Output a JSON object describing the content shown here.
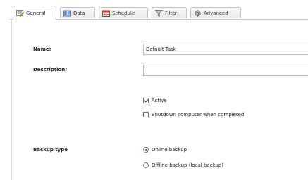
{
  "tabs": [
    {
      "label": "General",
      "icon": "general-icon",
      "active": true
    },
    {
      "label": "Data",
      "icon": "data-icon",
      "active": false
    },
    {
      "label": "Schedule",
      "icon": "calendar-icon",
      "active": false
    },
    {
      "label": "Filter",
      "icon": "filter-icon",
      "active": false
    },
    {
      "label": "Advanced",
      "icon": "gear-icon",
      "active": false
    }
  ],
  "form": {
    "name_label": "Name:",
    "name_value": "Default Task",
    "description_label": "Description:",
    "description_value": "",
    "active_label": "Active",
    "active_checked": true,
    "shutdown_label": "Shutdown computer when completed",
    "shutdown_checked": false,
    "backup_type_label": "Backup type",
    "backup_options": [
      {
        "label": "Online backup",
        "selected": true
      },
      {
        "label": "Offline backup (local backup)",
        "selected": false
      }
    ]
  },
  "colors": {
    "accent": "#2a62c9",
    "border": "#c4c4c4"
  }
}
